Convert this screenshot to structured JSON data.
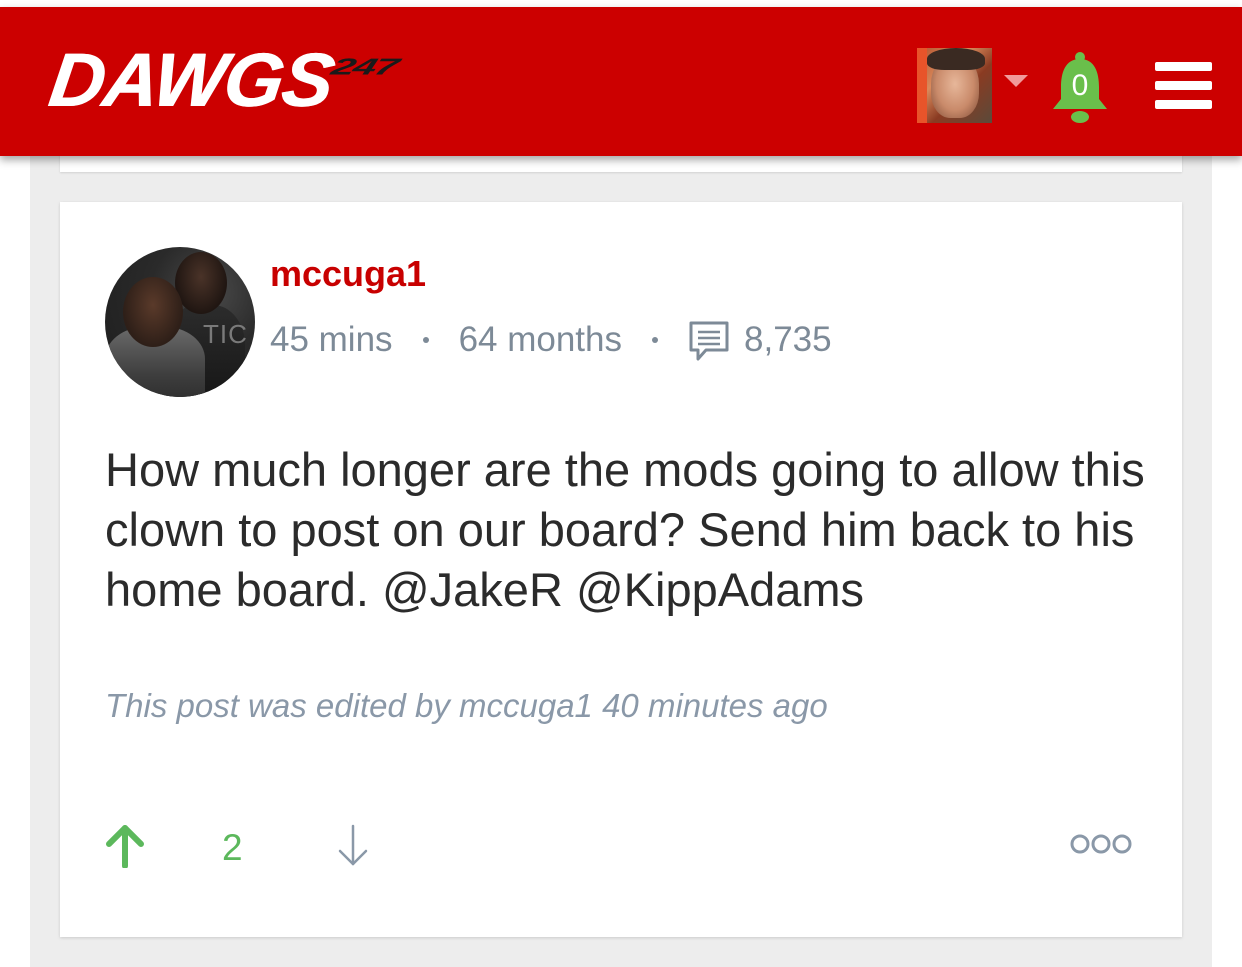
{
  "header": {
    "logo_text": "DAWGS",
    "logo_number": "247",
    "notification_count": "0",
    "colors": {
      "brand_red": "#cc0000",
      "bell_green": "#6abf4b"
    },
    "icons": [
      "user-avatar",
      "caret-down-icon",
      "bell-icon",
      "hamburger-menu-icon"
    ]
  },
  "post": {
    "author": "mccuga1",
    "time_ago": "45 mins",
    "member_duration": "64 months",
    "post_count": "8,735",
    "body": "How much longer are the mods going to allow this clown to post on our board? Send him back to his home board. @JakeR @KippAdams",
    "edited_note": "This post was edited by mccuga1 40 minutes ago",
    "vote_count": "2",
    "avatar_text": "TIC",
    "colors": {
      "username": "#c80000",
      "meta": "#7d8a97",
      "upvote": "#5cb85c"
    }
  }
}
